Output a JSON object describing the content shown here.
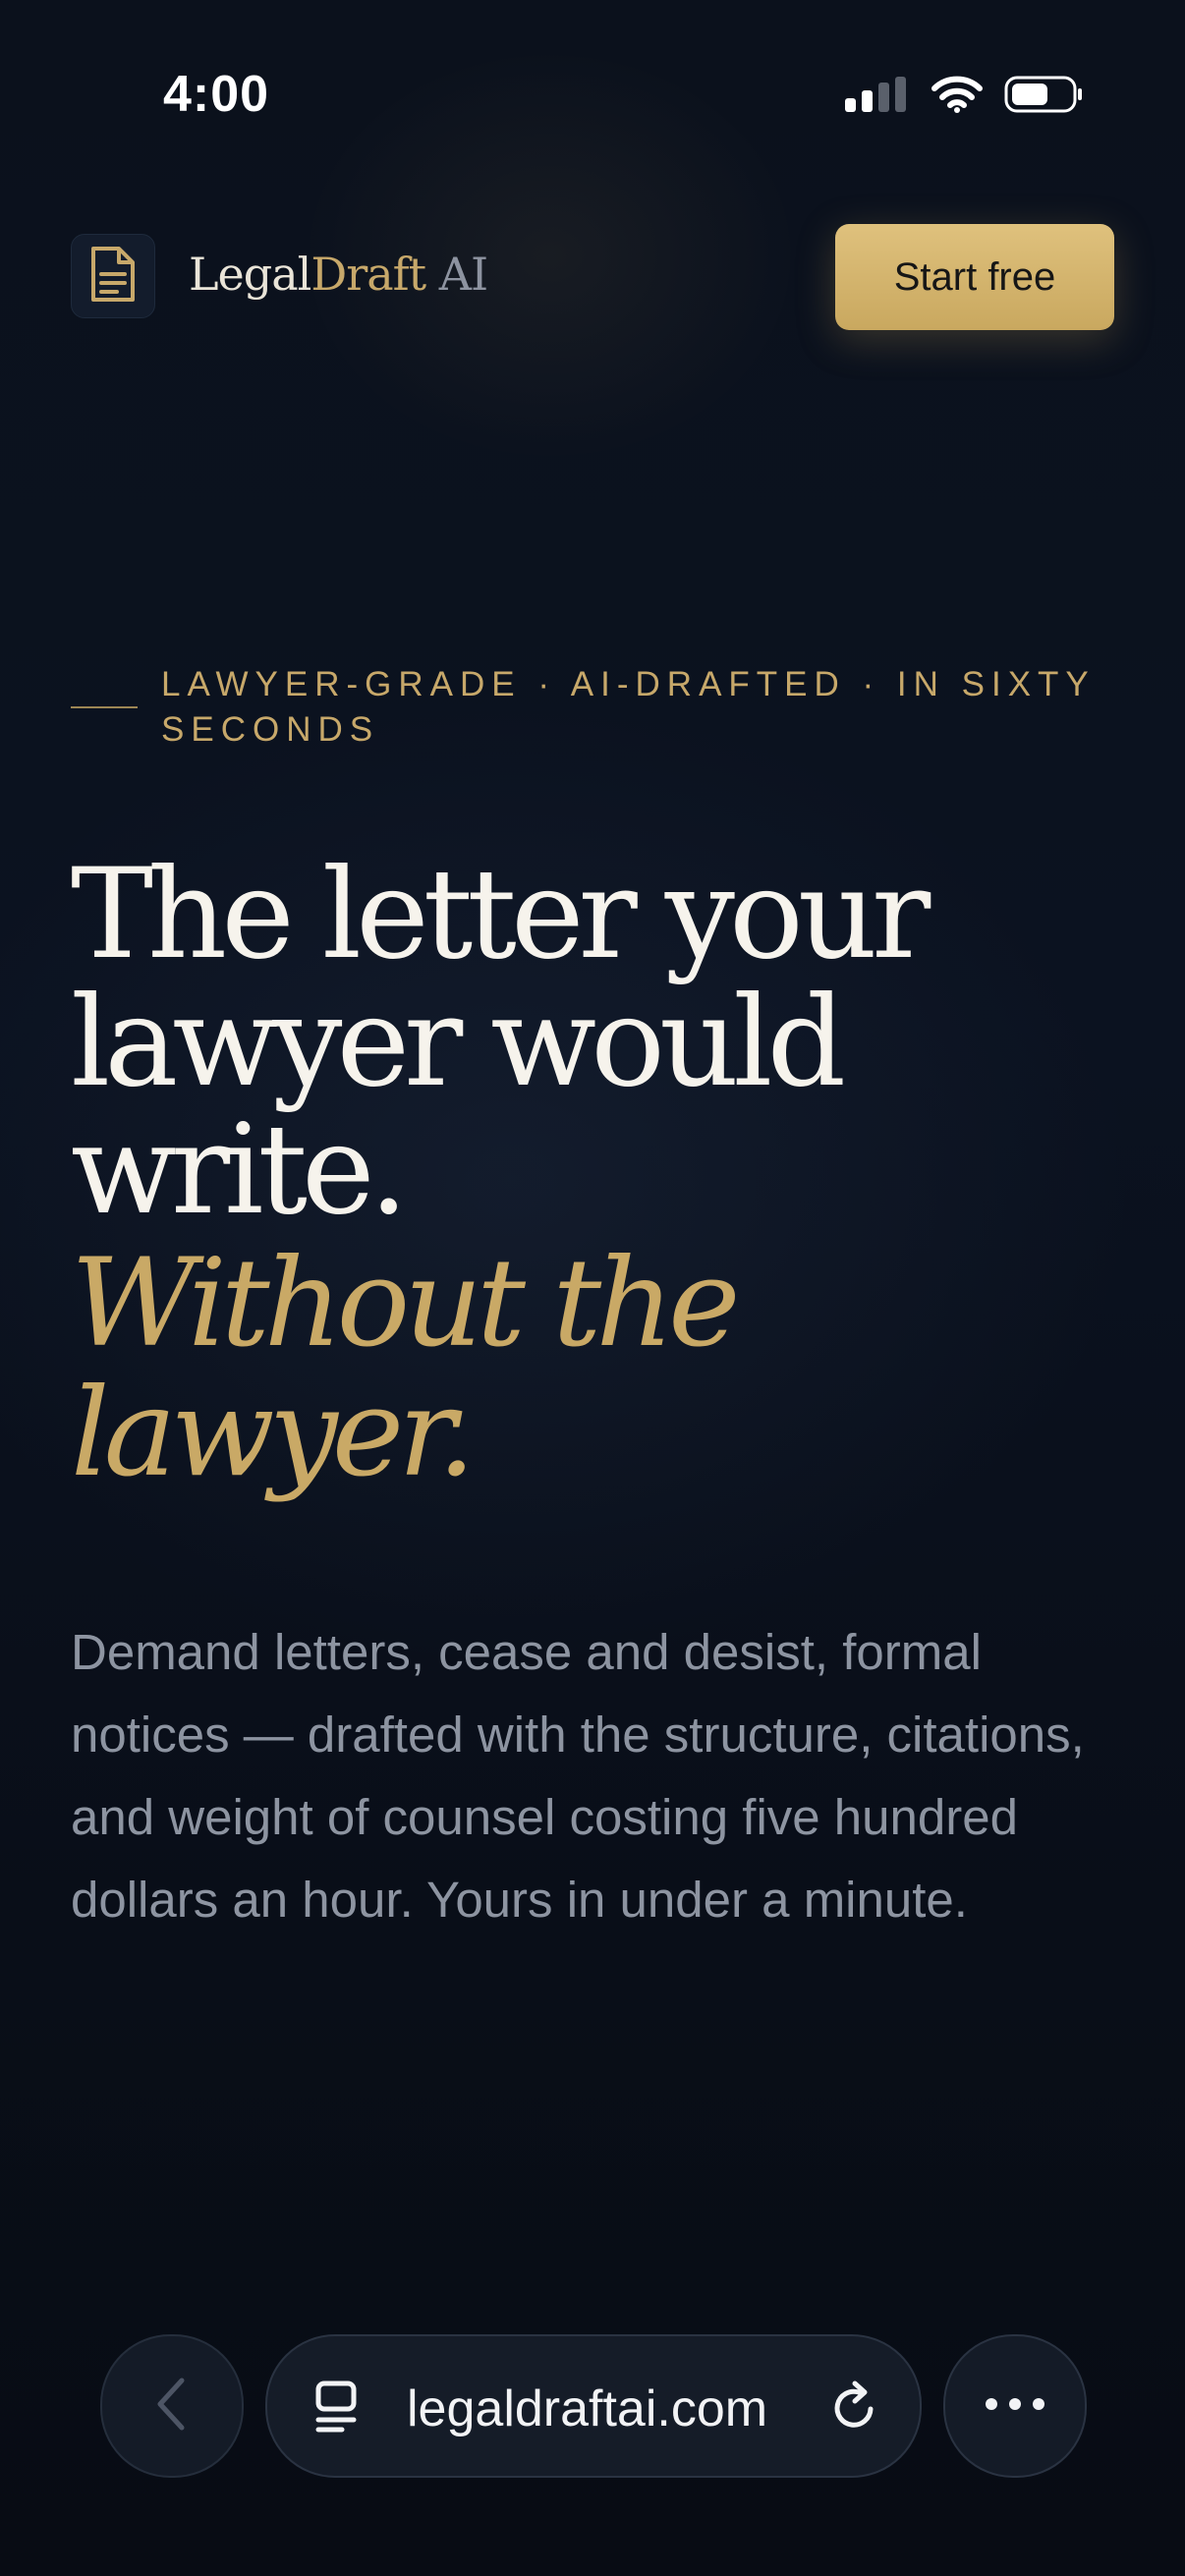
{
  "status_bar": {
    "time": "4:00",
    "icons": [
      "signal-icon",
      "wifi-icon",
      "battery-icon"
    ]
  },
  "header": {
    "logo_icon": "document-icon",
    "brand_part1": "Legal",
    "brand_part2": "Draft",
    "brand_part3": " AI",
    "cta_label": "Start free"
  },
  "hero": {
    "eyebrow": "LAWYER-GRADE · AI-DRAFTED · IN SIXTY SECONDS",
    "headline_line1": "The letter your",
    "headline_line2": "lawyer would",
    "headline_line3": "write.",
    "accent_line1": "Without the",
    "accent_line2": "lawyer.",
    "lead": "Demand letters, cease and desist, formal notices — drafted with the structure, citations, and weight of counsel costing five hundred dollars an hour. Yours in under a minute."
  },
  "browser_bar": {
    "back_icon": "chevron-left-icon",
    "tabs_icon": "tabs-icon",
    "url": "legaldraftai.com",
    "reload_icon": "reload-icon",
    "more_icon": "more-icon"
  },
  "colors": {
    "background": "#0a0f1a",
    "accent_gold": "#c9a966",
    "text_primary": "#f6f3ec",
    "text_muted": "#8d94a1"
  }
}
